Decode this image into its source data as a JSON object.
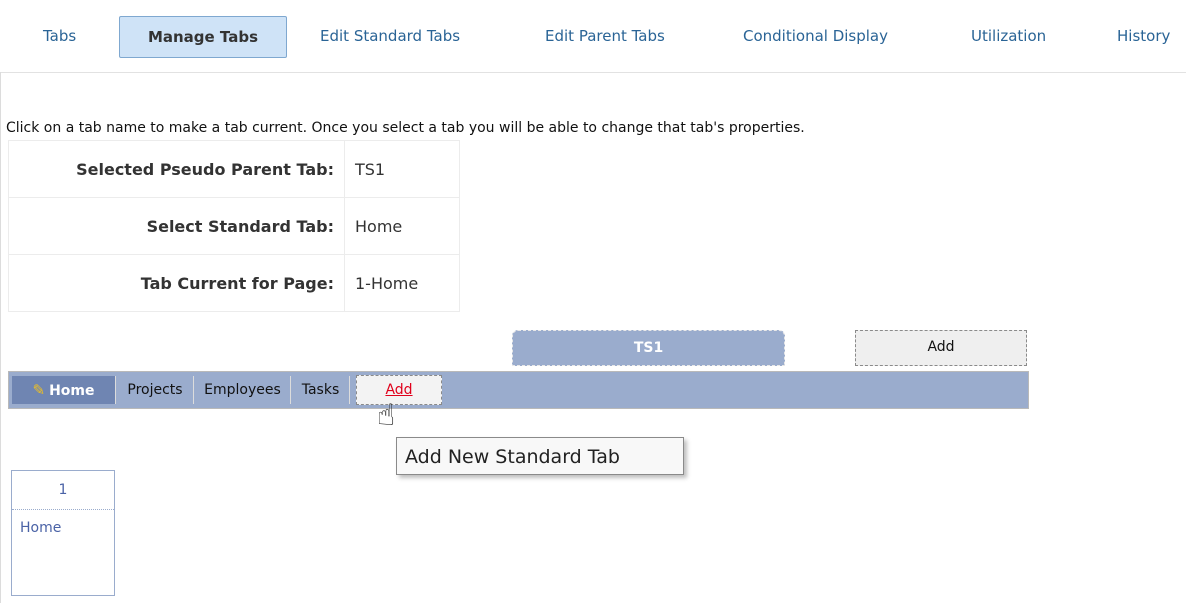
{
  "nav": {
    "items": [
      "Tabs",
      "Manage Tabs",
      "Edit Standard Tabs",
      "Edit Parent Tabs",
      "Conditional Display",
      "Utilization",
      "History"
    ],
    "active": "Manage Tabs"
  },
  "help_text": "Click on a tab name to make a tab current. Once you select a tab you will be able to change that tab's properties.",
  "properties": {
    "selected_parent_label": "Selected Pseudo Parent Tab:",
    "selected_parent_value": "TS1",
    "standard_tab_label": "Select Standard Tab:",
    "standard_tab_value": "Home",
    "tab_current_label": "Tab Current for Page:",
    "tab_current_value": "1-Home"
  },
  "parent_tabs": {
    "items": [
      "TS1"
    ],
    "add_label": "Add"
  },
  "standard_tabs": {
    "items": [
      "Home",
      "Projects",
      "Employees",
      "Tasks"
    ],
    "current": "Home",
    "add_label": "Add"
  },
  "tooltip": "Add New Standard Tab",
  "page_box": {
    "number": "1",
    "name": "Home"
  },
  "colors": {
    "tab_bar": "#9aaccd",
    "current_tab": "#6f85b2",
    "link": "#2a6496",
    "add_link": "#e0001b"
  }
}
